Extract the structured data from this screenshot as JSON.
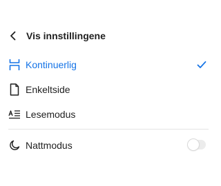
{
  "header": {
    "back_icon": "chevron-left-icon",
    "title": "Vis innstillingene"
  },
  "options": [
    {
      "label": "Kontinuerlig",
      "icon": "continuous-scroll-icon",
      "selected": true
    },
    {
      "label": "Enkeltside",
      "icon": "single-page-icon",
      "selected": false
    },
    {
      "label": "Lesemodus",
      "icon": "reading-mode-icon",
      "selected": false
    }
  ],
  "night_mode": {
    "label": "Nattmodus",
    "icon": "moon-icon",
    "enabled": false
  },
  "colors": {
    "accent": "#1473e6",
    "text": "#1f1f1f",
    "divider": "#e3e3e3"
  }
}
